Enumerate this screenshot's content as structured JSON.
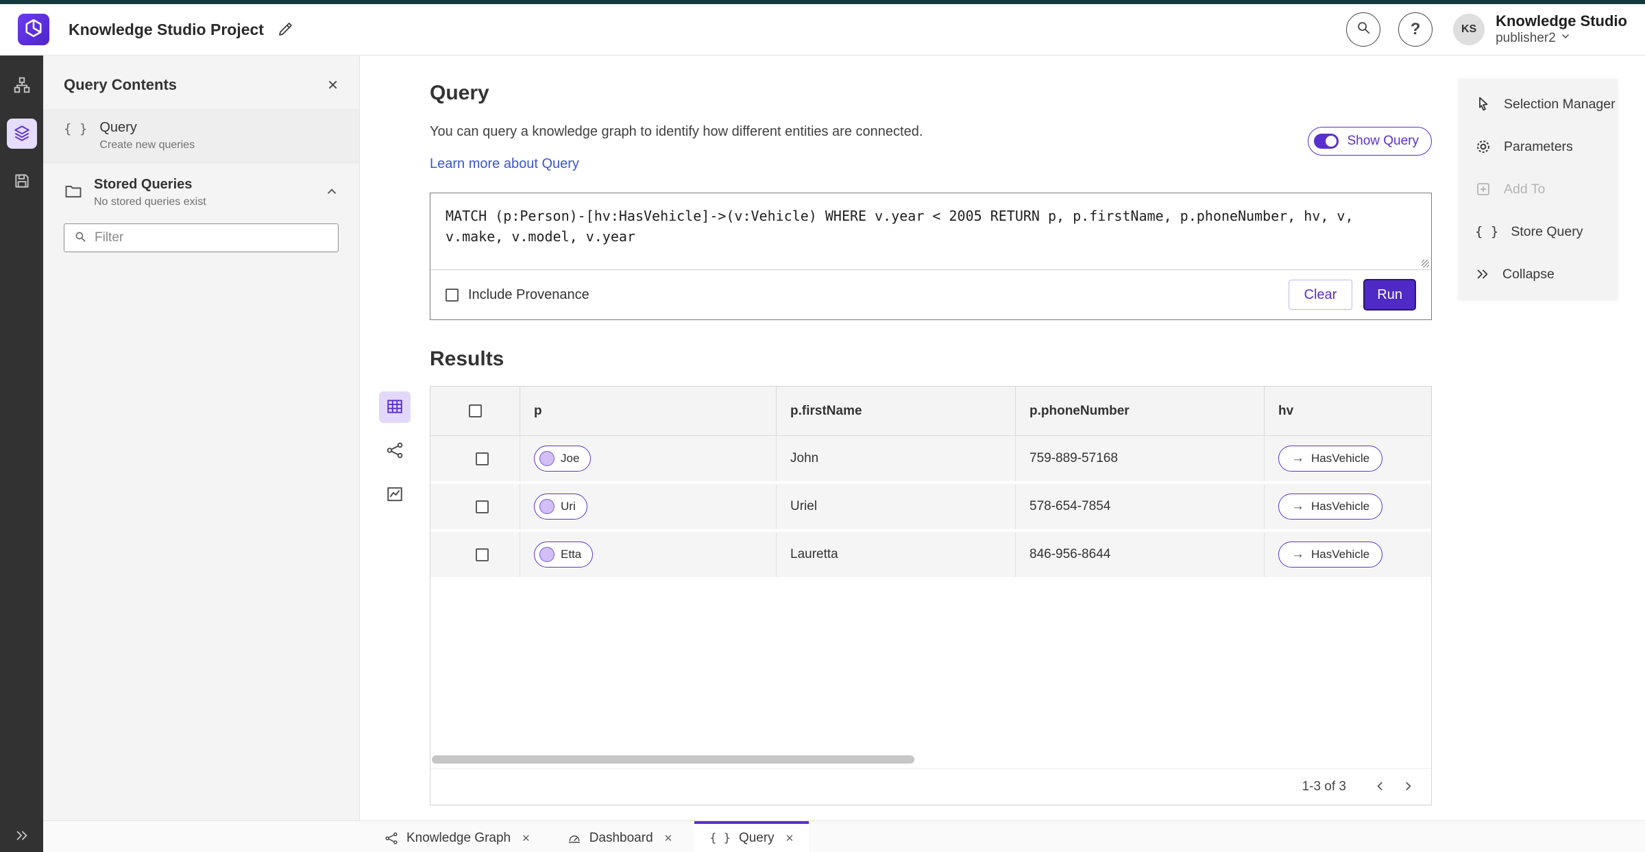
{
  "colors": {
    "accent": "#5a2fd0",
    "accent-deep": "#241a6e",
    "run": "#4f2ac6",
    "link": "#3b55d3",
    "rail": "#323232",
    "panel": "#f4f4f4",
    "strip": "#14383c"
  },
  "icons": {
    "braces": "{ }",
    "close": "✕",
    "arrow_right": "→",
    "question": "?"
  },
  "header": {
    "title": "Knowledge Studio Project",
    "product_name": "Knowledge Studio",
    "user_role": "publisher2",
    "avatar_initials": "KS"
  },
  "query_contents": {
    "title": "Query Contents",
    "query_item": {
      "label": "Query",
      "sublabel": "Create new queries"
    },
    "stored_queries": {
      "label": "Stored Queries",
      "sublabel": "No stored queries exist"
    },
    "filter_placeholder": "Filter"
  },
  "main": {
    "heading": "Query",
    "description": "You can query a knowledge graph to identify how different entities are connected.",
    "learn_more_label": "Learn more about Query",
    "show_query_label": "Show Query",
    "query_text": "MATCH (p:Person)-[hv:HasVehicle]->(v:Vehicle) WHERE v.year < 2005 RETURN p, p.firstName, p.phoneNumber, hv, v, v.make, v.model, v.year",
    "include_provenance_label": "Include Provenance",
    "clear_label": "Clear",
    "run_label": "Run",
    "results_heading": "Results"
  },
  "results_table": {
    "columns": [
      "p",
      "p.firstName",
      "p.phoneNumber",
      "hv"
    ],
    "rows": [
      {
        "p": "Joe",
        "firstName": "John",
        "phoneNumber": "759-889-57168",
        "hv": "HasVehicle"
      },
      {
        "p": "Uri",
        "firstName": "Uriel",
        "phoneNumber": "578-654-7854",
        "hv": "HasVehicle"
      },
      {
        "p": "Etta",
        "firstName": "Lauretta",
        "phoneNumber": "846-956-8644",
        "hv": "HasVehicle"
      }
    ],
    "pagination_label": "1-3 of 3"
  },
  "tools_panel": {
    "items": [
      {
        "label": "Selection Manager"
      },
      {
        "label": "Parameters"
      },
      {
        "label": "Add To"
      },
      {
        "label": "Store Query"
      },
      {
        "label": "Collapse"
      }
    ]
  },
  "bottom_tabs": [
    {
      "label": "Knowledge Graph"
    },
    {
      "label": "Dashboard"
    },
    {
      "label": "Query"
    }
  ]
}
